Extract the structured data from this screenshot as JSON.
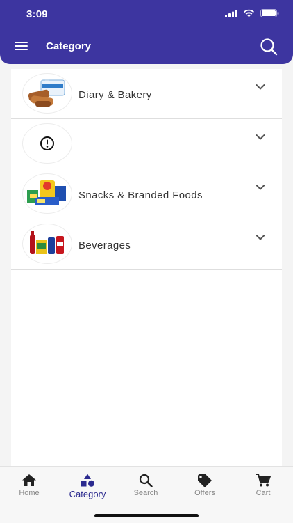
{
  "status_bar": {
    "time": "3:09"
  },
  "header": {
    "title": "Category"
  },
  "categories": [
    {
      "label": "Diary & Bakery",
      "icon": "dairy-bakery-image"
    },
    {
      "label": "",
      "icon": "image-missing-icon"
    },
    {
      "label": "Snacks & Branded Foods",
      "icon": "snacks-image"
    },
    {
      "label": "Beverages",
      "icon": "beverages-image"
    }
  ],
  "tabs": [
    {
      "label": "Home",
      "icon": "home-icon",
      "active": false
    },
    {
      "label": "Category",
      "icon": "category-icon",
      "active": true
    },
    {
      "label": "Search",
      "icon": "search-icon",
      "active": false
    },
    {
      "label": "Offers",
      "icon": "tag-icon",
      "active": false
    },
    {
      "label": "Cart",
      "icon": "cart-icon",
      "active": false
    }
  ],
  "colors": {
    "brand": "#3d35a0",
    "active_tab": "#2b2a8f",
    "inactive_tab": "#888888"
  }
}
